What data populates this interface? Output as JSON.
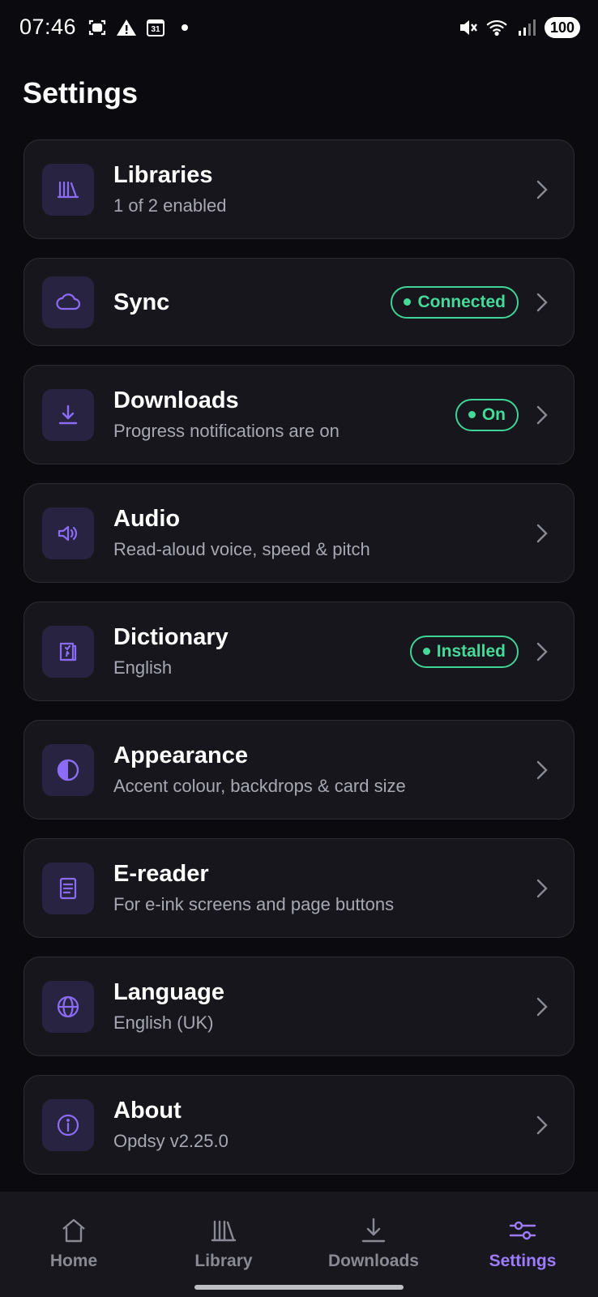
{
  "status_bar": {
    "time": "07:46",
    "left_icons": [
      "screenshot-icon",
      "warning-icon",
      "calendar-icon",
      "dot-icon"
    ],
    "calendar_day": "31",
    "right_icons": [
      "mute-icon",
      "wifi-icon",
      "signal-icon"
    ],
    "battery": "100"
  },
  "page": {
    "title": "Settings"
  },
  "accent_color": "#8b6cf6",
  "status_color": "#45d99a",
  "settings": [
    {
      "icon": "libraries-icon",
      "title": "Libraries",
      "subtitle": "1 of 2 enabled",
      "badge": ""
    },
    {
      "icon": "cloud-icon",
      "title": "Sync",
      "subtitle": "",
      "badge": "Connected"
    },
    {
      "icon": "download-icon",
      "title": "Downloads",
      "subtitle": "Progress notifications are on",
      "badge": "On"
    },
    {
      "icon": "speaker-icon",
      "title": "Audio",
      "subtitle": "Read-aloud voice, speed & pitch",
      "badge": ""
    },
    {
      "icon": "book-icon",
      "title": "Dictionary",
      "subtitle": "English",
      "badge": "Installed"
    },
    {
      "icon": "contrast-icon",
      "title": "Appearance",
      "subtitle": "Accent colour, backdrops & card size",
      "badge": ""
    },
    {
      "icon": "document-icon",
      "title": "E-reader",
      "subtitle": "For e-ink screens and page buttons",
      "badge": ""
    },
    {
      "icon": "globe-icon",
      "title": "Language",
      "subtitle": "English (UK)",
      "badge": ""
    },
    {
      "icon": "info-icon",
      "title": "About",
      "subtitle": "Opdsy v2.25.0",
      "badge": ""
    }
  ],
  "nav": {
    "home": "Home",
    "library": "Library",
    "downloads": "Downloads",
    "settings": "Settings",
    "active": "Settings"
  }
}
